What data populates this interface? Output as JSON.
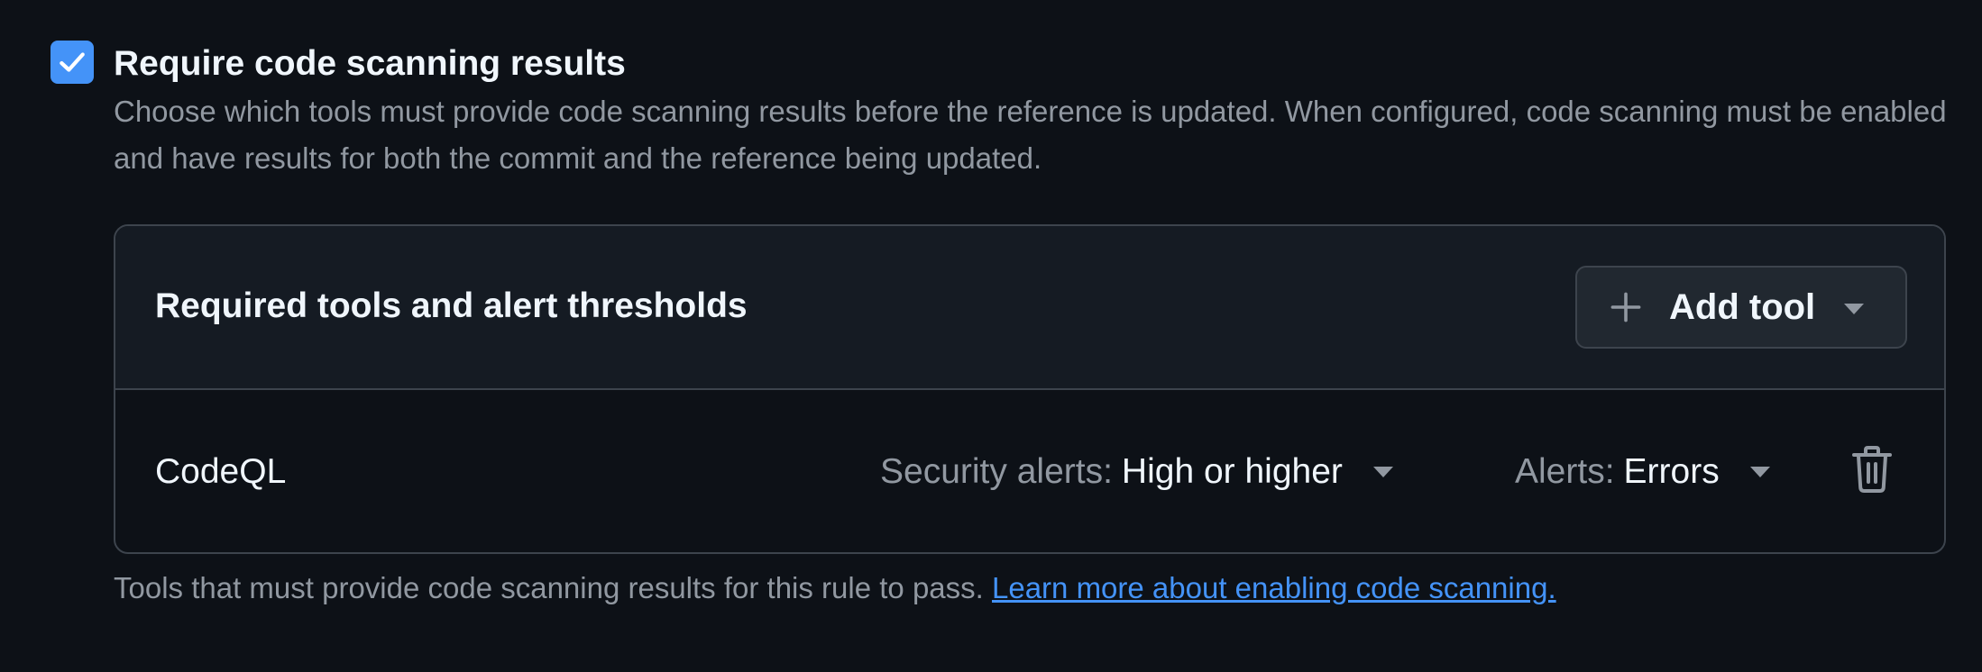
{
  "colors": {
    "accent": "#4493f8",
    "link": "#4493f8",
    "background": "#0d1117",
    "panel_header": "#151b23",
    "border": "#3d444d",
    "text_primary": "#f0f6fc",
    "text_muted": "#9198a1"
  },
  "rule": {
    "checked": true,
    "checkbox_icon": "check-icon",
    "title": "Require code scanning results",
    "description": "Choose which tools must provide code scanning results before the reference is updated. When configured, code scanning must be enabled and have results for both the commit and the reference being updated."
  },
  "panel": {
    "title": "Required tools and alert thresholds",
    "add_tool": {
      "label": "Add tool",
      "icon": "plus-icon",
      "caret_icon": "triangle-down-icon"
    },
    "tools": [
      {
        "name": "CodeQL",
        "security_alerts_label": "Security alerts:",
        "security_alerts_value": "High or higher",
        "alerts_label": "Alerts:",
        "alerts_value": "Errors",
        "delete_icon": "trash-icon"
      }
    ]
  },
  "footer": {
    "text": "Tools that must provide code scanning results for this rule to pass.",
    "link_text": "Learn more about enabling code scanning."
  }
}
